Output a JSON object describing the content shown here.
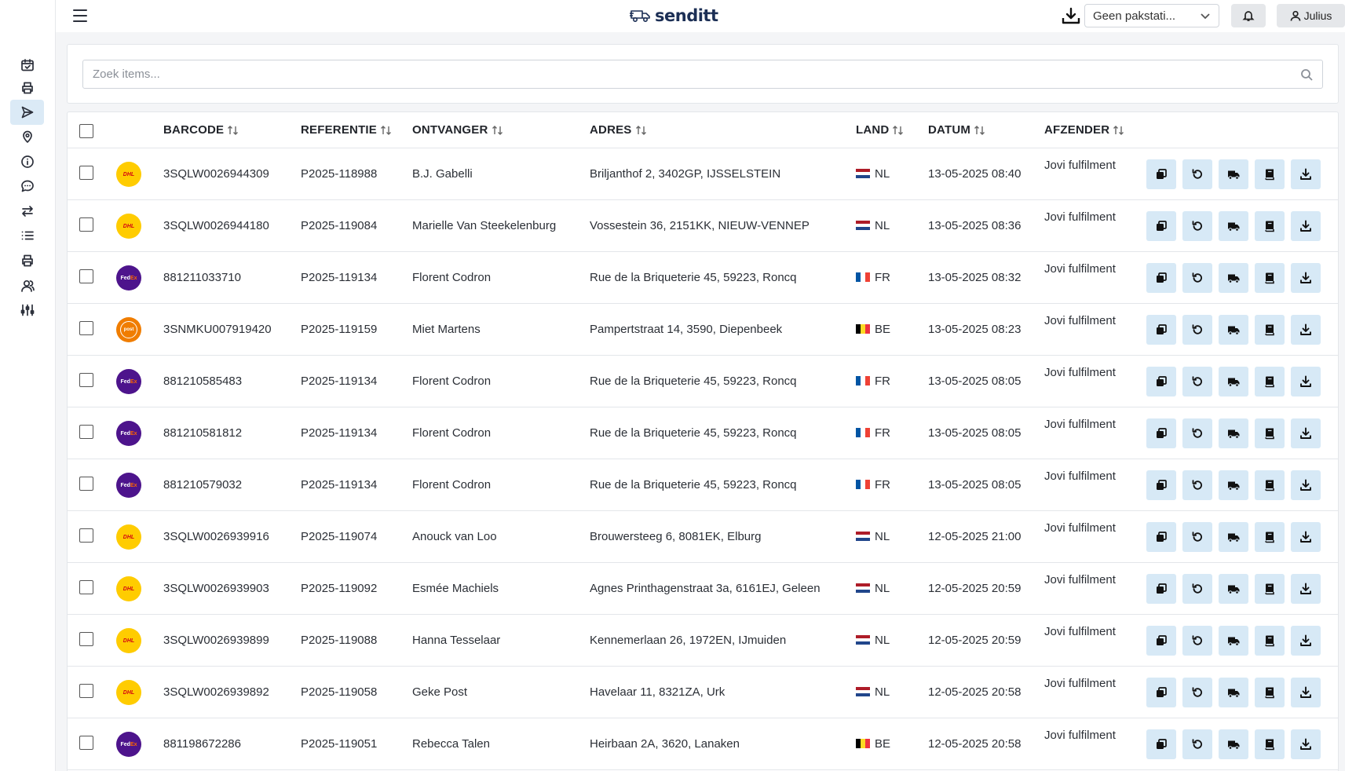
{
  "brand": {
    "name": "senditt",
    "color": "#1c2f55"
  },
  "header": {
    "station_select": "Geen pakstati...",
    "user_name": "Julius"
  },
  "sidebar": {
    "items": [
      {
        "icon": "calendar-check-icon",
        "active": false
      },
      {
        "icon": "printer-icon",
        "active": false
      },
      {
        "icon": "send-icon",
        "active": true
      },
      {
        "icon": "map-pin-icon",
        "active": false
      },
      {
        "icon": "info-icon",
        "active": false
      },
      {
        "icon": "chat-icon",
        "active": false
      },
      {
        "icon": "swap-arrows-icon",
        "active": false
      },
      {
        "icon": "list-icon",
        "active": false
      },
      {
        "icon": "printer-icon",
        "active": false
      },
      {
        "icon": "users-icon",
        "active": false
      },
      {
        "icon": "sliders-icon",
        "active": false
      }
    ]
  },
  "search": {
    "placeholder": "Zoek items..."
  },
  "table": {
    "columns": {
      "barcode": "BARCODE",
      "referentie": "REFERENTIE",
      "ontvanger": "ONTVANGER",
      "adres": "ADRES",
      "land": "LAND",
      "datum": "DATUM",
      "afzender": "AFZENDER"
    },
    "rows": [
      {
        "carrier": "dhl",
        "barcode": "3SQLW0026944309",
        "referentie": "P2025-118988",
        "ontvanger": "B.J. Gabelli",
        "adres": "Briljanthof 2, 3402GP, IJSSELSTEIN",
        "land": "NL",
        "datum": "13-05-2025 08:40",
        "afzender": "Jovi fulfilment"
      },
      {
        "carrier": "dhl",
        "barcode": "3SQLW0026944180",
        "referentie": "P2025-119084",
        "ontvanger": "Marielle Van Steekelenburg",
        "adres": "Vossestein 36, 2151KK, NIEUW-VENNEP",
        "land": "NL",
        "datum": "13-05-2025 08:36",
        "afzender": "Jovi fulfilment"
      },
      {
        "carrier": "fedex",
        "barcode": "881211033710",
        "referentie": "P2025-119134",
        "ontvanger": "Florent Codron",
        "adres": "Rue de la Briqueterie 45, 59223, Roncq",
        "land": "FR",
        "datum": "13-05-2025 08:32",
        "afzender": "Jovi fulfilment"
      },
      {
        "carrier": "postnl",
        "barcode": "3SNMKU007919420",
        "referentie": "P2025-119159",
        "ontvanger": "Miet Martens",
        "adres": "Pampertstraat 14, 3590, Diepenbeek",
        "land": "BE",
        "datum": "13-05-2025 08:23",
        "afzender": "Jovi fulfilment"
      },
      {
        "carrier": "fedex",
        "barcode": "881210585483",
        "referentie": "P2025-119134",
        "ontvanger": "Florent Codron",
        "adres": "Rue de la Briqueterie 45, 59223, Roncq",
        "land": "FR",
        "datum": "13-05-2025 08:05",
        "afzender": "Jovi fulfilment"
      },
      {
        "carrier": "fedex",
        "barcode": "881210581812",
        "referentie": "P2025-119134",
        "ontvanger": "Florent Codron",
        "adres": "Rue de la Briqueterie 45, 59223, Roncq",
        "land": "FR",
        "datum": "13-05-2025 08:05",
        "afzender": "Jovi fulfilment"
      },
      {
        "carrier": "fedex",
        "barcode": "881210579032",
        "referentie": "P2025-119134",
        "ontvanger": "Florent Codron",
        "adres": "Rue de la Briqueterie 45, 59223, Roncq",
        "land": "FR",
        "datum": "13-05-2025 08:05",
        "afzender": "Jovi fulfilment"
      },
      {
        "carrier": "dhl",
        "barcode": "3SQLW0026939916",
        "referentie": "P2025-119074",
        "ontvanger": "Anouck van Loo",
        "adres": "Brouwersteeg 6, 8081EK, Elburg",
        "land": "NL",
        "datum": "12-05-2025 21:00",
        "afzender": "Jovi fulfilment"
      },
      {
        "carrier": "dhl",
        "barcode": "3SQLW0026939903",
        "referentie": "P2025-119092",
        "ontvanger": "Esmée Machiels",
        "adres": "Agnes Printhagenstraat 3a, 6161EJ, Geleen",
        "land": "NL",
        "datum": "12-05-2025 20:59",
        "afzender": "Jovi fulfilment"
      },
      {
        "carrier": "dhl",
        "barcode": "3SQLW0026939899",
        "referentie": "P2025-119088",
        "ontvanger": "Hanna Tesselaar",
        "adres": "Kennemerlaan 26, 1972EN, IJmuiden",
        "land": "NL",
        "datum": "12-05-2025 20:59",
        "afzender": "Jovi fulfilment"
      },
      {
        "carrier": "dhl",
        "barcode": "3SQLW0026939892",
        "referentie": "P2025-119058",
        "ontvanger": "Geke Post",
        "adres": "Havelaar 11, 8321ZA, Urk",
        "land": "NL",
        "datum": "12-05-2025 20:58",
        "afzender": "Jovi fulfilment"
      },
      {
        "carrier": "fedex",
        "barcode": "881198672286",
        "referentie": "P2025-119051",
        "ontvanger": "Rebecca Talen",
        "adres": "Heirbaan 2A, 3620, Lanaken",
        "land": "BE",
        "datum": "12-05-2025 20:58",
        "afzender": "Jovi fulfilment"
      }
    ],
    "row_actions": [
      "duplicate-icon",
      "return-icon",
      "truck-icon",
      "book-icon",
      "download-icon"
    ],
    "action_color": "#d7e9f6"
  }
}
